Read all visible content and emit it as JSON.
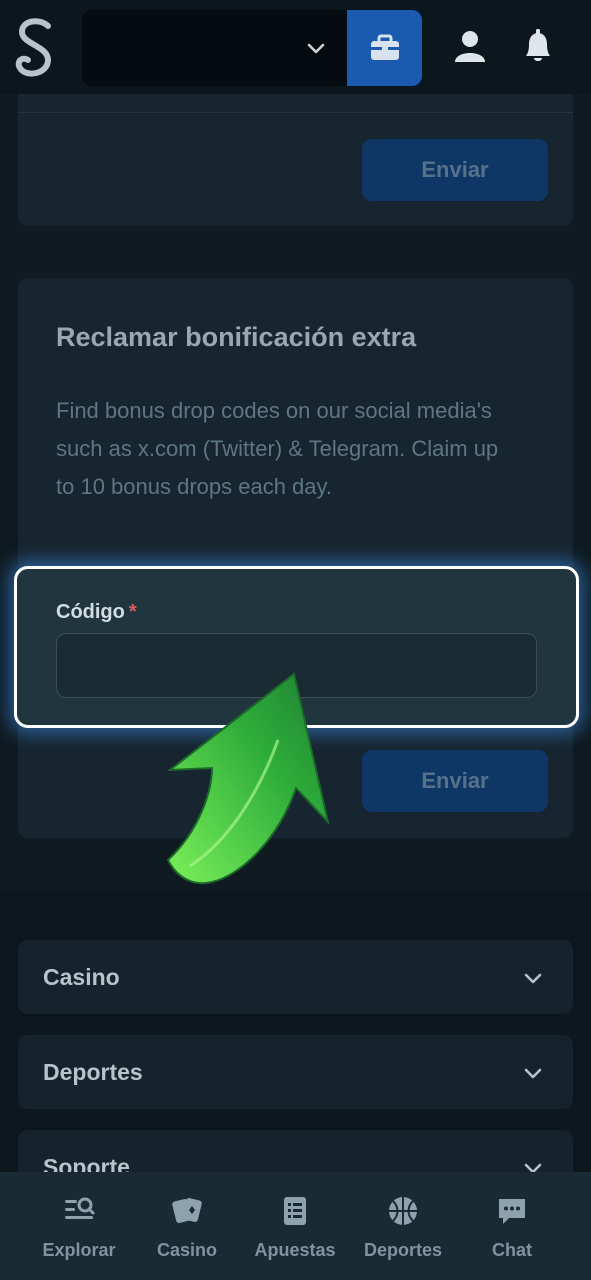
{
  "colors": {
    "accent": "#1a5bb0",
    "required": "#e05a5a",
    "arrow": "#3cc43c"
  },
  "header": {
    "logo_icon": "script-s-logo",
    "wallet_chevron_icon": "chevron-down-icon",
    "wallet_button_icon": "wallet-icon",
    "user_icon": "user-icon",
    "bell_icon": "bell-icon"
  },
  "card_top": {
    "submit_label": "Enviar"
  },
  "bonus_card": {
    "title": "Reclamar bonificación extra",
    "description": "Find bonus drop codes on our social media's such as x.com (Twitter) & Telegram. Claim up to 10 bonus drops each day.",
    "code_label": "Código",
    "required_mark": "*",
    "code_value": "",
    "submit_label": "Enviar"
  },
  "footer": {
    "sections": [
      {
        "label": "Casino"
      },
      {
        "label": "Deportes"
      },
      {
        "label": "Soporte"
      }
    ]
  },
  "bottom_nav": [
    {
      "label": "Explorar",
      "icon": "explore-icon"
    },
    {
      "label": "Casino",
      "icon": "cards-icon"
    },
    {
      "label": "Apuestas",
      "icon": "betslip-icon"
    },
    {
      "label": "Deportes",
      "icon": "basketball-icon"
    },
    {
      "label": "Chat",
      "icon": "chat-icon"
    }
  ]
}
